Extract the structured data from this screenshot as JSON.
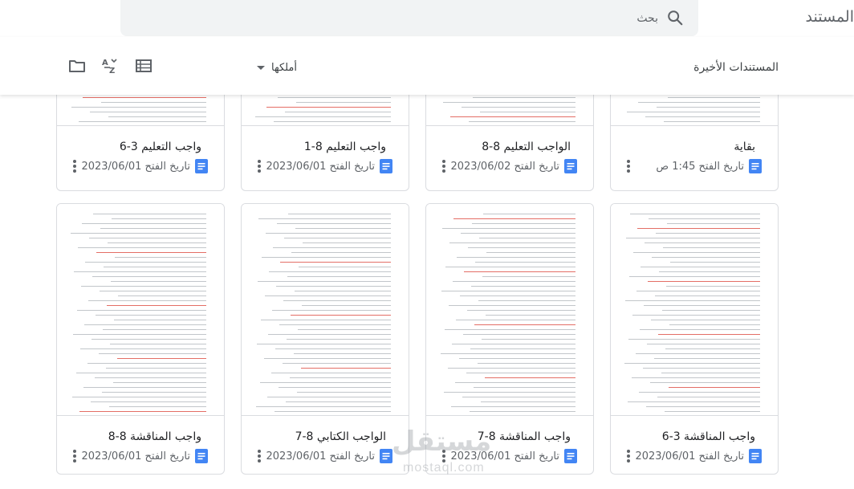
{
  "header": {
    "app_title": "المستندات",
    "search_placeholder": "بحث"
  },
  "toolbar": {
    "section_title": "المستندات الأخيرة",
    "owner_filter": "أملكها",
    "icons": [
      "list-view-icon",
      "sort-az-icon",
      "folder-icon"
    ]
  },
  "documents": [
    {
      "title": "بقاية",
      "date": "تاريخ الفتح 1:45 ص"
    },
    {
      "title": "الواجب التعليم 8-8",
      "date": "تاريخ الفتح 2023/06/02"
    },
    {
      "title": "واجب التعليم 8-1",
      "date": "تاريخ الفتح 2023/06/01"
    },
    {
      "title": "واجب التعليم 3-6",
      "date": "تاريخ الفتح 2023/06/01"
    },
    {
      "title": "واجب المناقشة 3-6",
      "date": "تاريخ الفتح 2023/06/01"
    },
    {
      "title": "واجب المناقشة 8-7",
      "date": "تاريخ الفتح 2023/06/01"
    },
    {
      "title": "الواجب الكتابي 8-7",
      "date": "تاريخ الفتح 2023/06/01"
    },
    {
      "title": "واجب المناقشة 8-8",
      "date": "تاريخ الفتح 2023/06/01"
    }
  ],
  "watermark": {
    "main": "مستقل",
    "sub": "mostaql.com"
  },
  "colors": {
    "docs_blue": "#4285f4",
    "border": "#dadce0",
    "search_bg": "#f1f3f4"
  }
}
